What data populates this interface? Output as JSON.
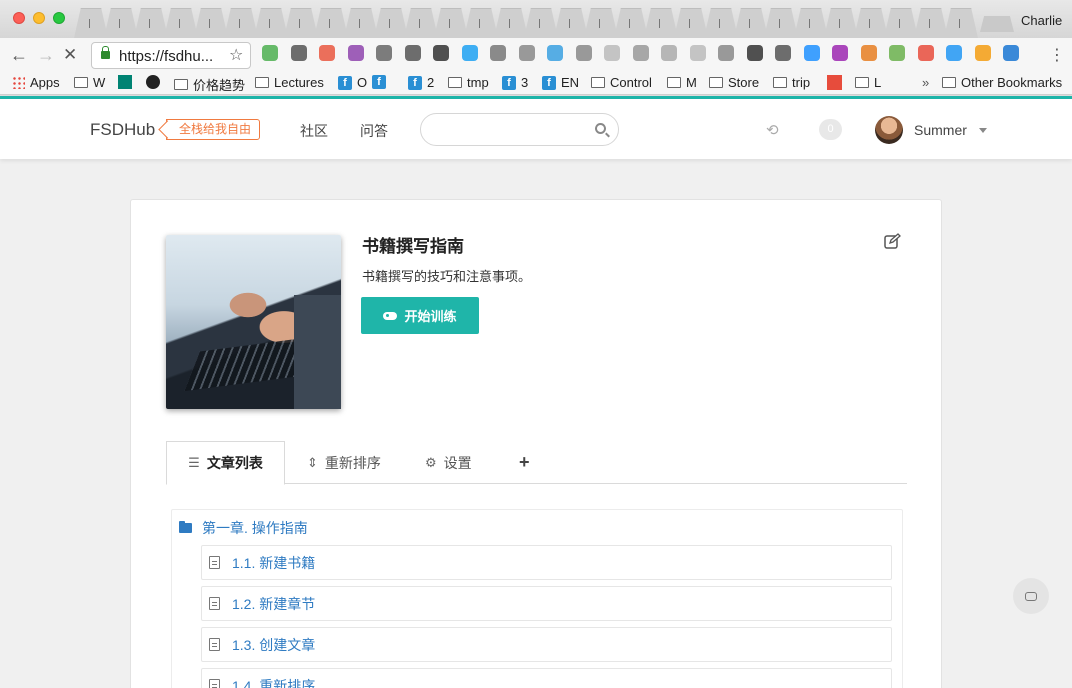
{
  "browser": {
    "profile_name": "Charlie",
    "url": "https://fsdhu...",
    "bookmarks": [
      {
        "label": "Apps",
        "icon": "apps-grid-icon"
      },
      {
        "label": "W",
        "icon": "folder-icon"
      },
      {
        "label": "",
        "icon": "bing-icon"
      },
      {
        "label": "",
        "icon": "github-icon"
      },
      {
        "label": "价格趋势",
        "icon": "folder-icon"
      },
      {
        "label": "Lectures",
        "icon": "folder-icon"
      },
      {
        "label": "O",
        "icon": "facebook-icon"
      },
      {
        "label": "",
        "icon": "facebook-icon"
      },
      {
        "label": "2",
        "icon": "facebook-icon"
      },
      {
        "label": "tmp",
        "icon": "folder-icon"
      },
      {
        "label": "3",
        "icon": "facebook-icon"
      },
      {
        "label": "EN",
        "icon": "facebook-icon"
      },
      {
        "label": "Control",
        "icon": "folder-icon"
      },
      {
        "label": "M",
        "icon": "folder-icon"
      },
      {
        "label": "Store",
        "icon": "folder-icon"
      },
      {
        "label": "trip",
        "icon": "folder-icon"
      },
      {
        "label": "",
        "icon": "scrum-icon"
      },
      {
        "label": "L",
        "icon": "folder-icon"
      }
    ],
    "overflow_label": "»",
    "other_bookmarks": "Other Bookmarks"
  },
  "site": {
    "brand": "FSDHub",
    "slogan": "全栈给我自由",
    "nav": [
      "社区",
      "问答"
    ],
    "search_placeholder": "",
    "notification_count": "0",
    "username": "Summer"
  },
  "book": {
    "title": "书籍撰写指南",
    "description": "书籍撰写的技巧和注意事项。",
    "train_button": "开始训练"
  },
  "tabs": [
    {
      "label": "文章列表",
      "icon": "list-icon",
      "active": true
    },
    {
      "label": "重新排序",
      "icon": "sort-icon",
      "active": false
    },
    {
      "label": "设置",
      "icon": "gears-icon",
      "active": false
    },
    {
      "label": "",
      "icon": "plus-icon",
      "active": false
    }
  ],
  "tab_glyphs": {
    "list": "☰",
    "sort": "⇕",
    "gears": "⚙",
    "plus": "+"
  },
  "toc": {
    "chapter": "第一章. 操作指南",
    "articles": [
      "1.1. 新建书籍",
      "1.2. 新建章节",
      "1.3. 创建文章",
      "1.4. 重新排序"
    ]
  },
  "colors": {
    "accent": "#1fb5a9",
    "link": "#2f7bc2",
    "slogan": "#f07a40"
  }
}
